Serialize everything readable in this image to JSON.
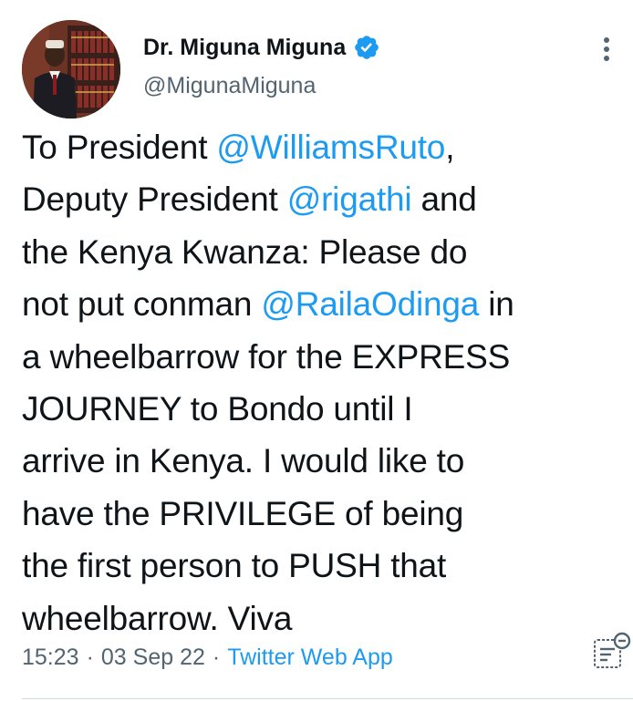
{
  "author": {
    "display_name": "Dr. Miguna Miguna",
    "handle": "@MigunaMiguna",
    "verified": true
  },
  "tweet": {
    "lines": [
      [
        "To President ",
        "@WilliamsRuto",
        ","
      ],
      [
        "Deputy President ",
        "@rigathi",
        " and"
      ],
      [
        "the Kenya Kwanza: Please do",
        "",
        ""
      ],
      [
        "not put conman ",
        "@RailaOdinga",
        " in"
      ],
      [
        "a wheelbarrow for the EXPRESS",
        "",
        ""
      ],
      [
        "JOURNEY to Bondo until I",
        "",
        ""
      ],
      [
        "arrive in Kenya. I would like to",
        "",
        ""
      ],
      [
        "have the PRIVILEGE of being",
        "",
        ""
      ],
      [
        "the first person to PUSH that",
        "",
        ""
      ],
      [
        "wheelbarrow. Viva",
        "",
        ""
      ]
    ]
  },
  "meta": {
    "time": "15:23",
    "separator": "·",
    "date": "03 Sep 22",
    "source": "Twitter Web App"
  },
  "icons": {
    "verified": "verified-badge-icon",
    "more": "more-options-icon",
    "analytics": "view-analytics-icon"
  },
  "colors": {
    "accent": "#1d9bf0",
    "text": "#0f1419",
    "secondary": "#536471"
  }
}
